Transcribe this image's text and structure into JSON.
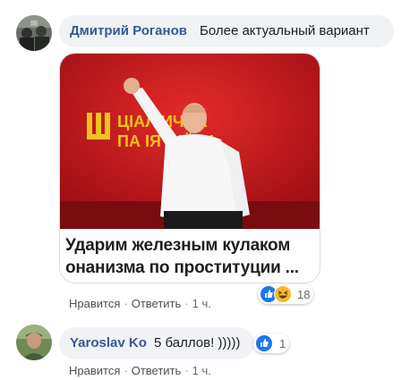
{
  "comments": [
    {
      "author": "Дмитрий Роганов",
      "text": "Более актуальный вариант",
      "image_caption_line1": "Ударим железным кулаком",
      "image_caption_line2": "онанизма по проституции ...",
      "banner_text_line1": "ЦІАЛ    ИЧНА",
      "banner_text_line2": "ПА   ІЯ   РАЇНИ",
      "like_label": "Нравится",
      "reply_label": "Ответить",
      "time": "1 ч.",
      "reaction_count": "18",
      "reaction_icons": [
        "like-icon",
        "haha-icon"
      ]
    },
    {
      "author": "Yaroslav Ko",
      "text": "5 баллов! )))))",
      "like_label": "Нравится",
      "reply_label": "Ответить",
      "time": "1 ч.",
      "reaction_count": "1",
      "reaction_icons": [
        "like-icon"
      ]
    }
  ],
  "separator": "·",
  "colors": {
    "author": "#385898",
    "bubble": "#f0f2f5",
    "like_blue": "#1877f2",
    "haha_yellow": "#f7b928",
    "banner_red": "#c8171e"
  }
}
